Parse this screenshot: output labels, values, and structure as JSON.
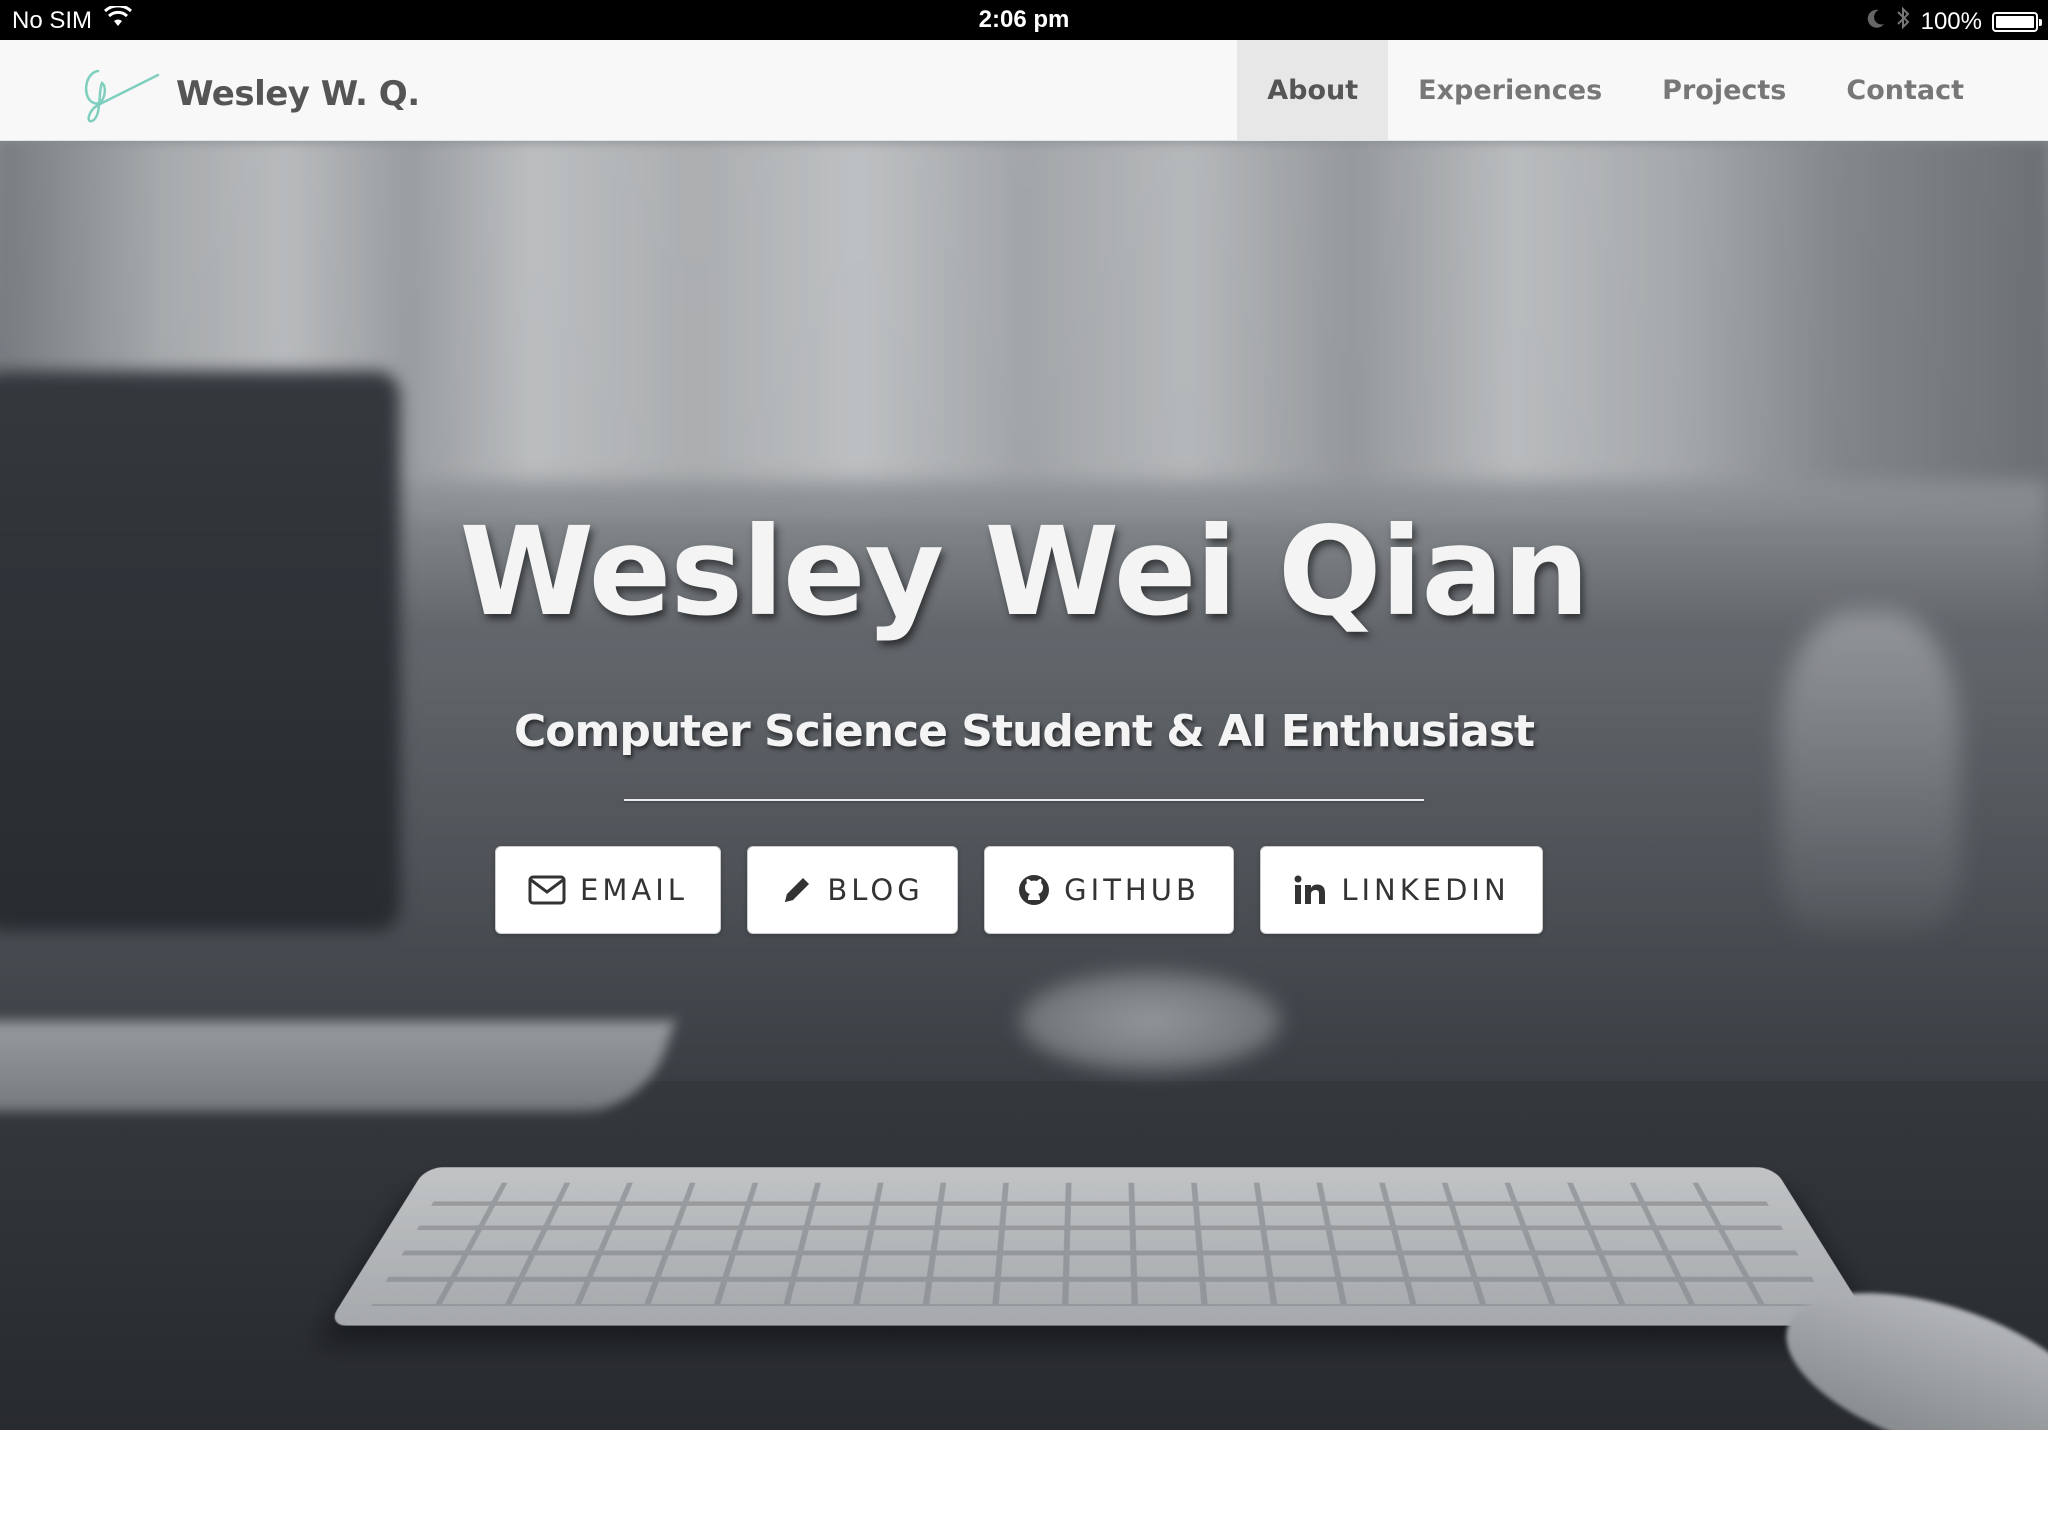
{
  "status_bar": {
    "carrier": "No SIM",
    "time": "2:06 pm",
    "battery_text": "100%",
    "battery_level": 1.0,
    "icons": [
      "wifi-icon",
      "moon-icon",
      "bluetooth-icon",
      "battery-icon"
    ]
  },
  "navbar": {
    "brand": "Wesley W. Q.",
    "logo_icon": "signature-logo",
    "logo_color": "#7fcfbe",
    "items": [
      {
        "label": "About",
        "active": true
      },
      {
        "label": "Experiences",
        "active": false
      },
      {
        "label": "Projects",
        "active": false
      },
      {
        "label": "Contact",
        "active": false
      }
    ]
  },
  "hero": {
    "title": "Wesley Wei Qian",
    "subtitle": "Computer Science Student & AI Enthusiast",
    "buttons": [
      {
        "label": "EMAIL",
        "icon": "envelope-icon"
      },
      {
        "label": "BLOG",
        "icon": "pencil-icon"
      },
      {
        "label": "GITHUB",
        "icon": "github-icon"
      },
      {
        "label": "LINKEDIN",
        "icon": "linkedin-icon"
      }
    ]
  },
  "colors": {
    "navbar_bg": "#f8f8f8",
    "nav_active_bg": "#e7e7e7",
    "nav_text": "#777777",
    "hero_text": "#f4f4f4",
    "button_bg": "#ffffff",
    "button_text": "#333333"
  }
}
